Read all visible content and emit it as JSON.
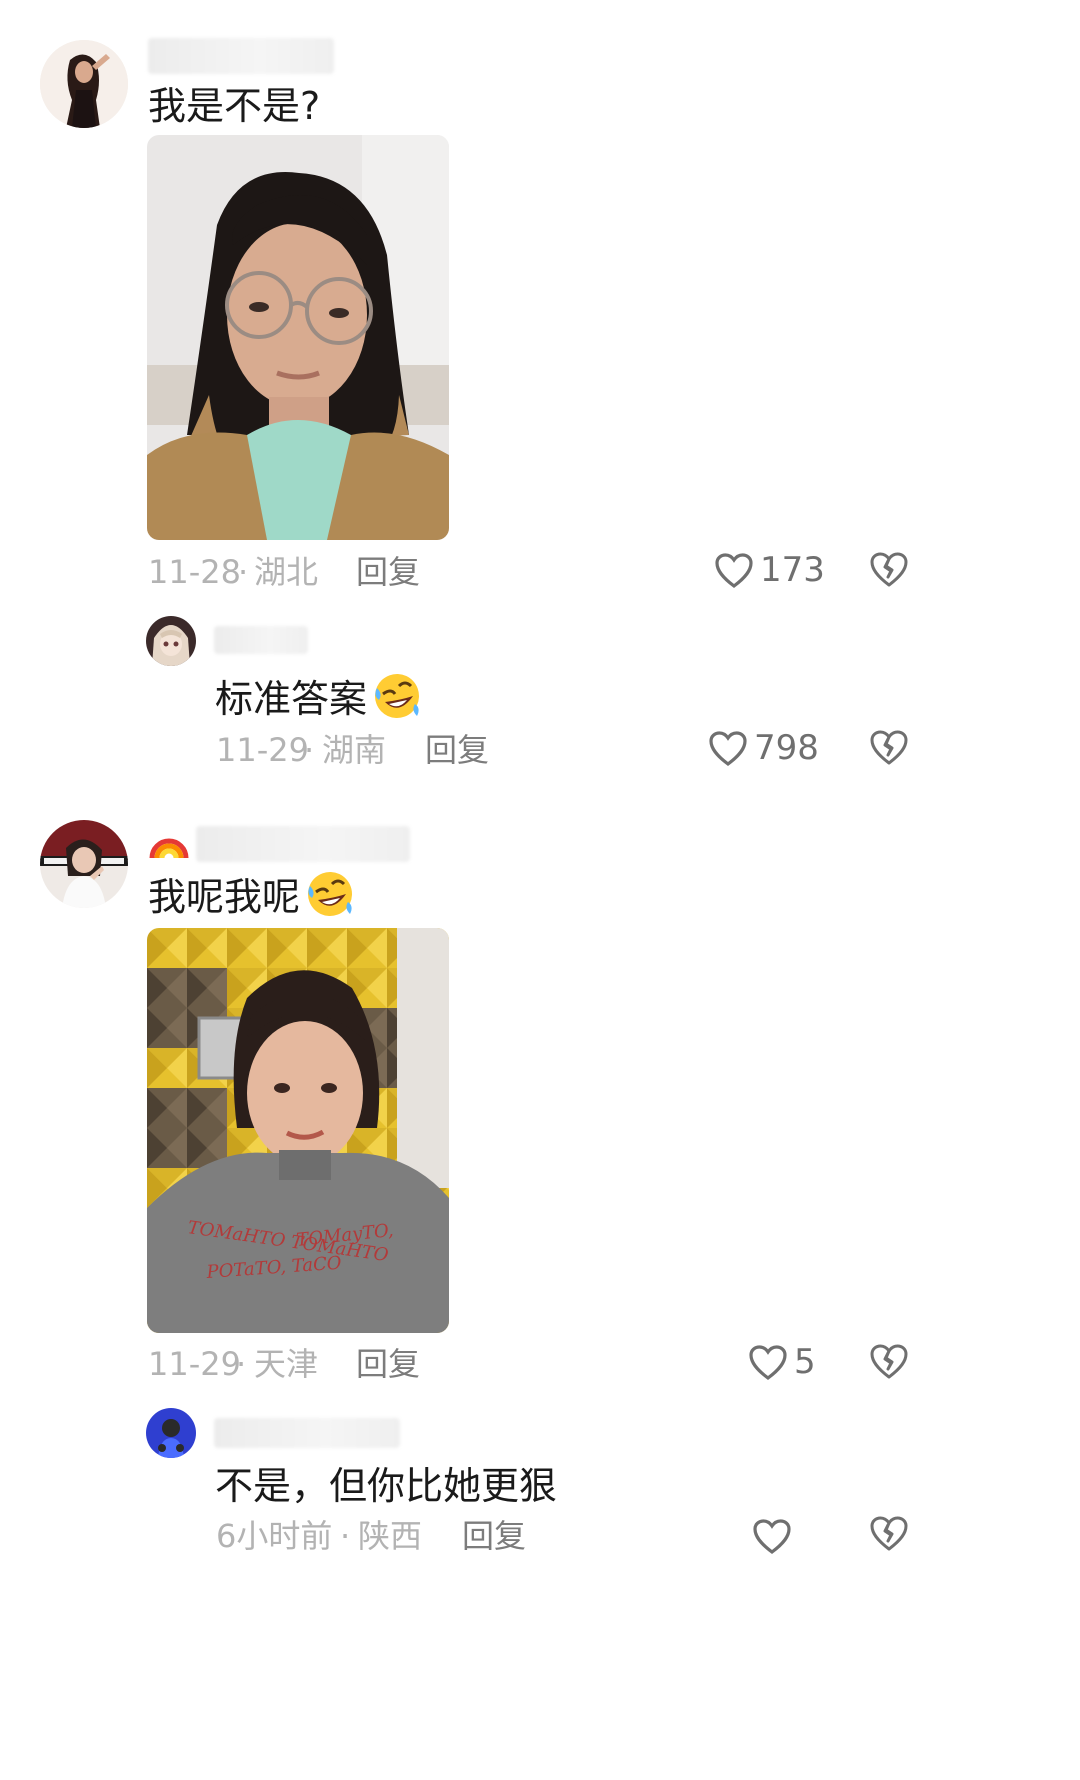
{
  "comments": [
    {
      "text": "我是不是?",
      "date": "11-28",
      "location": "湖北",
      "reply_label": "回复",
      "likes": "173",
      "avatar": "profile-photo-woman-dark-hair",
      "photo": "selfie-woman-glasses-tan-cardigan",
      "replies": [
        {
          "text": "标准答案",
          "emoji": "rolling-on-floor-laughing-emoji",
          "date": "11-29",
          "location": "湖南",
          "reply_label": "回复",
          "likes": "798",
          "avatar": "anime-girl-avatar"
        }
      ]
    },
    {
      "text": "我呢我呢",
      "emoji": "rolling-on-floor-laughing-emoji",
      "badge": "rainbow-emoji",
      "date": "11-29",
      "location": "天津",
      "reply_label": "回复",
      "likes": "5",
      "avatar": "profile-photo-woman-piano-studio",
      "photo": "selfie-woman-bangs-gray-sweater-studio",
      "photo_shirt_text": [
        "TOMaHTO TOMaHTO",
        "TOMayTO,",
        "POTaTO, TaCO"
      ],
      "replies": [
        {
          "text": "不是，但你比她更狠",
          "date": "6小时前",
          "location": "陕西",
          "reply_label": "回复",
          "likes": "",
          "avatar": "blue-figure-avatar"
        }
      ]
    }
  ],
  "colors": {
    "meta": "#b3b3b3",
    "reply": "#7c7c7c",
    "icon": "#6f6f6f"
  }
}
